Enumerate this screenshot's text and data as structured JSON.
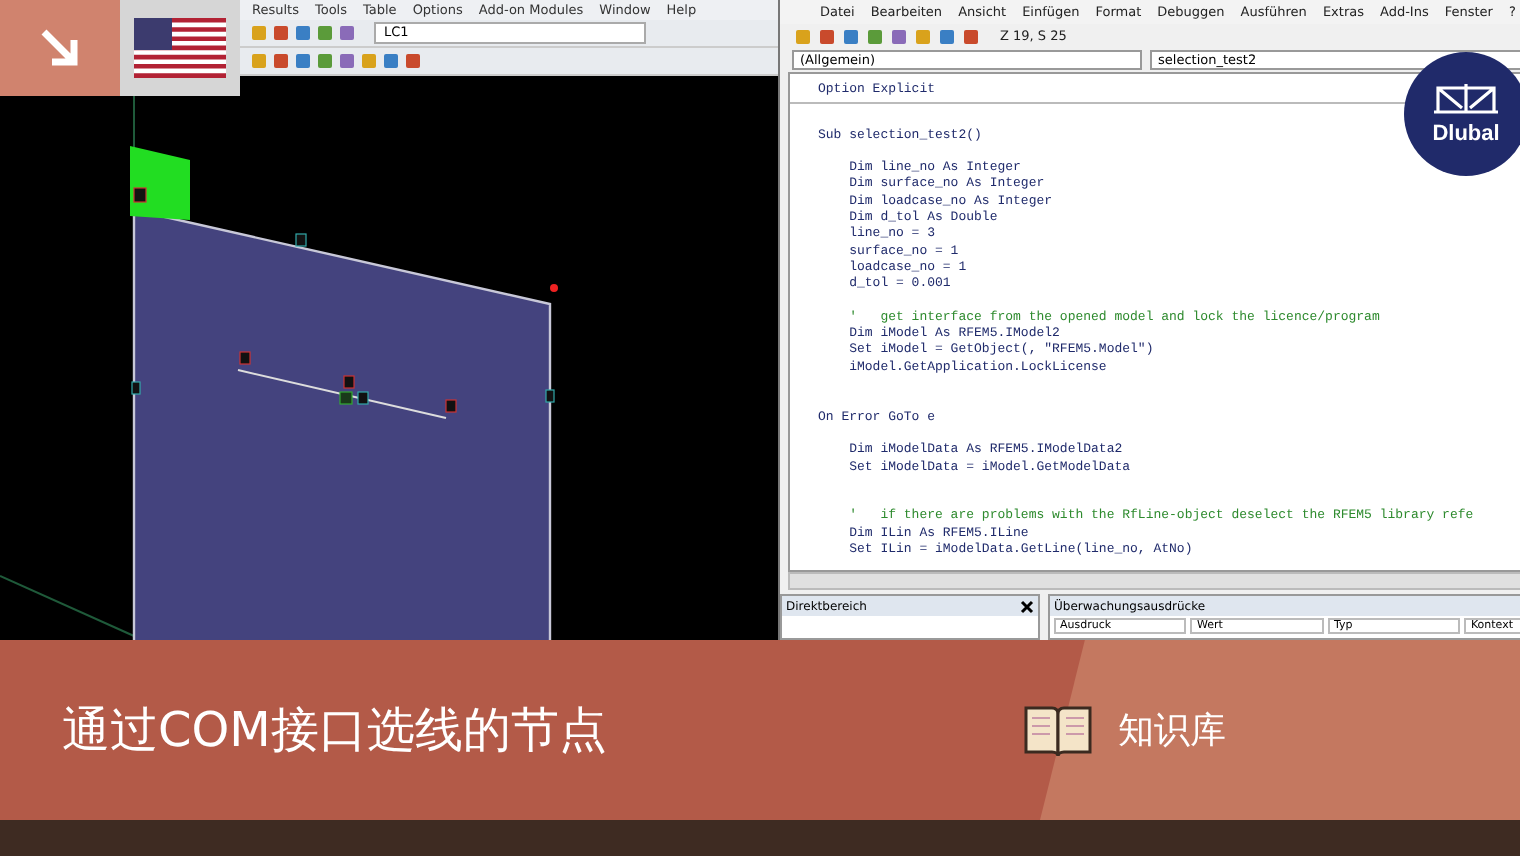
{
  "rfem": {
    "menu": [
      "Results",
      "Tools",
      "Table",
      "Options",
      "Add-on Modules",
      "Window",
      "Help"
    ],
    "load_case": "LC1"
  },
  "vba": {
    "menu": [
      "Datei",
      "Bearbeiten",
      "Ansicht",
      "Einfügen",
      "Format",
      "Debuggen",
      "Ausführen",
      "Extras",
      "Add-Ins",
      "Fenster",
      "?"
    ],
    "cursor_position": "Z 19, S 25",
    "object_box": "(Allgemein)",
    "procedure_box": "selection_test2",
    "code": [
      {
        "kind": "code",
        "text": "Option Explicit"
      },
      {
        "kind": "divider"
      },
      {
        "kind": "blank"
      },
      {
        "kind": "code",
        "text": "Sub selection_test2()"
      },
      {
        "kind": "blank"
      },
      {
        "kind": "code",
        "text": "    Dim line_no As Integer"
      },
      {
        "kind": "code",
        "text": "    Dim surface_no As Integer"
      },
      {
        "kind": "code",
        "text": "    Dim loadcase_no As Integer"
      },
      {
        "kind": "code",
        "text": "    Dim d_tol As Double"
      },
      {
        "kind": "code",
        "text": "    line_no = 3"
      },
      {
        "kind": "code",
        "text": "    surface_no = 1"
      },
      {
        "kind": "code",
        "text": "    loadcase_no = 1"
      },
      {
        "kind": "code",
        "text": "    d_tol = 0.001"
      },
      {
        "kind": "blank"
      },
      {
        "kind": "comment",
        "text": "    '   get interface from the opened model and lock the licence/program"
      },
      {
        "kind": "code",
        "text": "    Dim iModel As RFEM5.IModel2"
      },
      {
        "kind": "code",
        "text": "    Set iModel = GetObject(, \"RFEM5.Model\")"
      },
      {
        "kind": "code",
        "text": "    iModel.GetApplication.LockLicense"
      },
      {
        "kind": "blank"
      },
      {
        "kind": "blank"
      },
      {
        "kind": "code",
        "text": "On Error GoTo e"
      },
      {
        "kind": "blank"
      },
      {
        "kind": "code",
        "text": "    Dim iModelData As RFEM5.IModelData2"
      },
      {
        "kind": "code",
        "text": "    Set iModelData = iModel.GetModelData"
      },
      {
        "kind": "blank"
      },
      {
        "kind": "blank"
      },
      {
        "kind": "comment",
        "text": "    '   if there are problems with the RfLine-object deselect the RFEM5 library refe"
      },
      {
        "kind": "code",
        "text": "    Dim ILin As RFEM5.ILine"
      },
      {
        "kind": "code",
        "text": "    Set ILin = iModelData.GetLine(line_no, AtNo)"
      }
    ],
    "immediate_title": "Direktbereich",
    "watch_title": "Überwachungsausdrücke",
    "watch_columns": [
      "Ausdruck",
      "Wert",
      "Typ",
      "Kontext"
    ]
  },
  "logo": {
    "text": "Dlubal"
  },
  "banner": {
    "title": "通过COM接口选线的节点",
    "category": "知识库"
  }
}
